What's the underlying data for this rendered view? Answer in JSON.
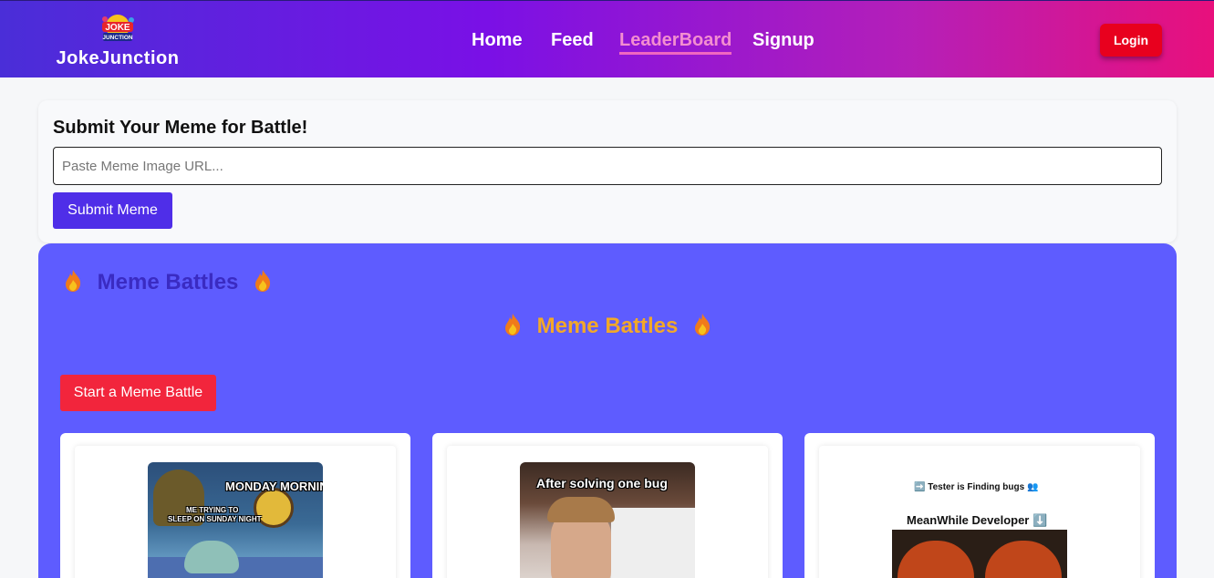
{
  "brand": {
    "name": "JokeJunction",
    "logo_line1": "JOKE",
    "logo_line2": "JUNCTION"
  },
  "nav": {
    "links": [
      {
        "label": "Home",
        "active": false
      },
      {
        "label": "Feed",
        "active": false
      },
      {
        "label": "LeaderBoard",
        "active": true
      },
      {
        "label": "Signup",
        "active": false
      }
    ],
    "login_label": "Login"
  },
  "submit": {
    "title": "Submit Your Meme for Battle!",
    "placeholder": "Paste Meme Image URL...",
    "button_label": "Submit Meme"
  },
  "battles": {
    "heading": "Meme Battles",
    "subheading": "Meme Battles",
    "start_label": "Start a Meme Battle",
    "flame_icon": "fire-icon",
    "memes": [
      {
        "top_text": "MONDAY MORNING",
        "side_text_1": "ME TRYING TO",
        "side_text_2": "SLEEP ON SUNDAY NIGHT"
      },
      {
        "top_text": "After solving one bug"
      },
      {
        "top_text": "➡️ Tester is Finding bugs 👥",
        "second_text": "MeanWhile Developer ⬇️"
      }
    ]
  },
  "colors": {
    "accent": "#4f2ee8",
    "battle_bg": "#5e5cff",
    "danger": "#f2253c",
    "login": "#e8001e",
    "active_nav": "#f38ed0"
  }
}
